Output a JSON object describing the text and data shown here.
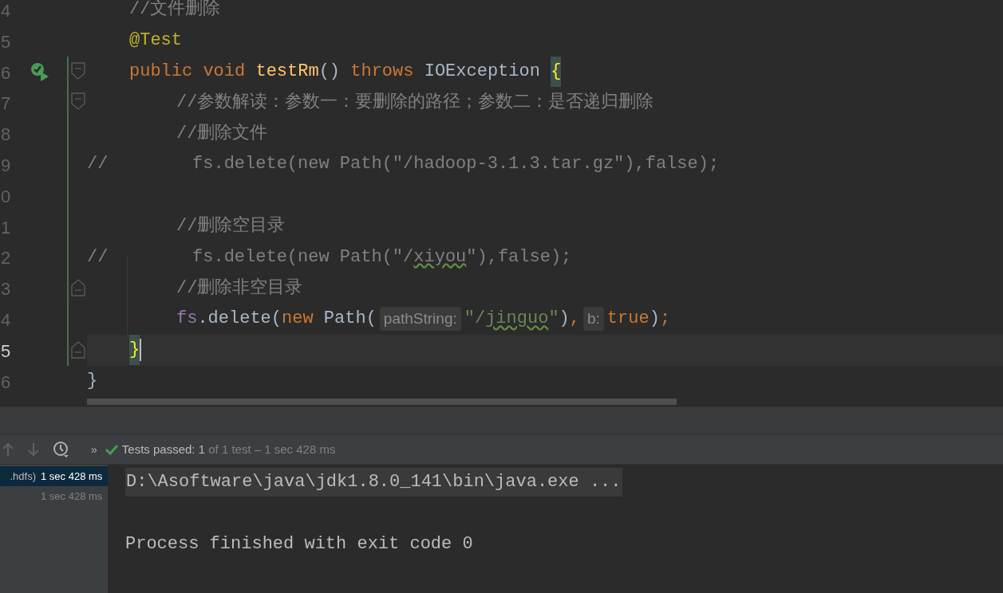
{
  "editor": {
    "lines": [
      {
        "number": "4",
        "kind": "member",
        "current": false,
        "changed": false,
        "run_icon": false,
        "fold_start": false,
        "fold_end": false,
        "tokens": [
          {
            "kind": "comment",
            "text": "//文件删除"
          }
        ]
      },
      {
        "number": "5",
        "kind": "member",
        "current": false,
        "changed": false,
        "run_icon": false,
        "fold_start": false,
        "fold_end": false,
        "tokens": [
          {
            "kind": "annotation",
            "text": "@Test"
          }
        ]
      },
      {
        "number": "6",
        "kind": "member",
        "current": false,
        "changed": true,
        "run_icon": true,
        "fold_start": true,
        "fold_end": false,
        "tokens": [
          {
            "kind": "keyword",
            "text": "public void "
          },
          {
            "kind": "method",
            "text": "testRm"
          },
          {
            "kind": "plain",
            "text": "() "
          },
          {
            "kind": "keyword",
            "text": "throws"
          },
          {
            "kind": "plain",
            "text": " IOException "
          },
          {
            "kind": "brace_match",
            "text": "{"
          }
        ]
      },
      {
        "number": "7",
        "kind": "body",
        "current": false,
        "changed": true,
        "run_icon": false,
        "fold_start": true,
        "fold_end": false,
        "tokens": [
          {
            "kind": "comment",
            "text": "//参数解读：参数一：要删除的路径；参数二：是否递归删除"
          }
        ]
      },
      {
        "number": "8",
        "kind": "body",
        "current": false,
        "changed": true,
        "run_icon": false,
        "fold_start": false,
        "fold_end": false,
        "tokens": [
          {
            "kind": "comment",
            "text": "//删除文件"
          }
        ]
      },
      {
        "number": "9",
        "kind": "top",
        "current": false,
        "changed": true,
        "run_icon": false,
        "fold_start": false,
        "fold_end": false,
        "tokens": [
          {
            "kind": "comment",
            "text": "//        fs.delete(new Path(\"/hadoop-3.1.3.tar.gz\"),false);"
          }
        ]
      },
      {
        "number": "0",
        "kind": "top",
        "current": false,
        "changed": true,
        "run_icon": false,
        "fold_start": false,
        "fold_end": false
      },
      {
        "number": "1",
        "kind": "body",
        "current": false,
        "changed": true,
        "run_icon": false,
        "fold_start": false,
        "fold_end": false,
        "tokens": [
          {
            "kind": "comment",
            "text": "//删除空目录"
          }
        ]
      },
      {
        "number": "2",
        "kind": "top",
        "current": false,
        "changed": true,
        "run_icon": false,
        "fold_start": false,
        "fold_end": false,
        "tokens": [
          {
            "kind": "comment",
            "text": "//        fs.delete(new Path(\"/"
          },
          {
            "kind": "comment_typo",
            "text": "xiyou"
          },
          {
            "kind": "comment",
            "text": "\"),false);"
          }
        ]
      },
      {
        "number": "3",
        "kind": "body",
        "current": false,
        "changed": true,
        "run_icon": false,
        "fold_start": false,
        "fold_end": true,
        "tokens": [
          {
            "kind": "comment",
            "text": "//删除非空目录"
          }
        ]
      },
      {
        "number": "4",
        "kind": "body",
        "current": false,
        "changed": true,
        "run_icon": false,
        "fold_start": false,
        "fold_end": false,
        "tokens": [
          {
            "kind": "field",
            "text": "fs"
          },
          {
            "kind": "plain",
            "text": ".delete("
          },
          {
            "kind": "keyword",
            "text": "new"
          },
          {
            "kind": "plain",
            "text": " Path("
          },
          {
            "kind": "hint",
            "text": "pathString:"
          },
          {
            "kind": "string",
            "text": "\"/"
          },
          {
            "kind": "string_typo",
            "text": "jinguo"
          },
          {
            "kind": "string",
            "text": "\""
          },
          {
            "kind": "plain",
            "text": ")"
          },
          {
            "kind": "keyword",
            "text": ","
          },
          {
            "kind": "hint",
            "text": "b:"
          },
          {
            "kind": "keyword",
            "text": "true"
          },
          {
            "kind": "plain",
            "text": ")"
          },
          {
            "kind": "keyword",
            "text": ";"
          }
        ]
      },
      {
        "number": "5",
        "kind": "member",
        "current": true,
        "changed": true,
        "run_icon": false,
        "fold_start": false,
        "fold_end": true,
        "tokens": [
          {
            "kind": "brace_match",
            "text": "}"
          }
        ]
      },
      {
        "number": "6",
        "kind": "top",
        "current": false,
        "changed": false,
        "run_icon": false,
        "fold_start": false,
        "fold_end": false,
        "tokens": [
          {
            "kind": "plain",
            "text": "}"
          }
        ]
      }
    ]
  },
  "run_panel": {
    "toolbar": {
      "more": "»",
      "status_label": "Tests passed:",
      "passed": "1",
      "detail": "of 1 test – 1 sec 428 ms"
    },
    "tree": [
      {
        "label": ".hdfs)",
        "time": "1 sec 428 ms",
        "selected": true
      },
      {
        "time": "1 sec 428 ms",
        "selected": false
      }
    ],
    "console": [
      {
        "kind": "folded",
        "text": "D:\\Asoftware\\java\\jdk1.8.0_141\\bin\\java.exe ..."
      },
      {
        "kind": "blank"
      },
      {
        "kind": "plain",
        "text": "Process finished with exit code 0"
      }
    ]
  }
}
